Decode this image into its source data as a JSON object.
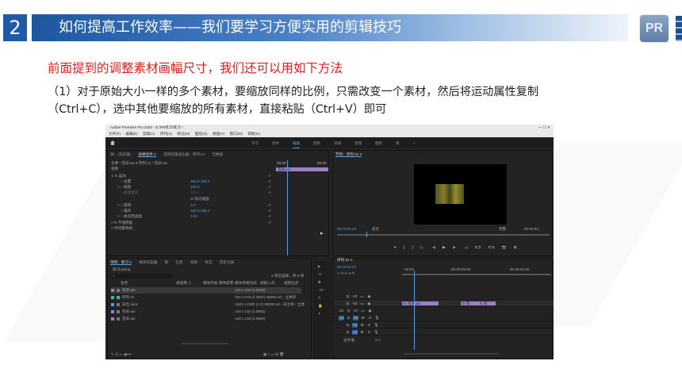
{
  "slide": {
    "number": "2",
    "title": "如何提高工作效率——我们要学习方便实用的剪辑技巧",
    "logo_text": "PR",
    "subtitle": "前面提到的调整素材画幅尺寸，我们还可以用如下方法",
    "paragraph": "（1）对于原始大小一样的多个素材，要缩放同样的比例，只需改变一个素材，然后将运动属性复制（Ctrl+C），选中其他要缩放的所有素材，直接粘贴（Ctrl+V）即可"
  },
  "app": {
    "window_title": "Adobe Premiere Pro 2020 - E:\\PR练习\\练习 *",
    "window_controls": "—  ☐  ✕",
    "menu": [
      "文件(F)",
      "编辑(E)",
      "剪辑(C)",
      "序列(S)",
      "标记(M)",
      "图形(G)",
      "视图(V)",
      "窗口(W)",
      "帮助(H)"
    ],
    "workspaces": [
      "学习",
      "组件",
      "编辑",
      "颜色",
      "效果",
      "音频",
      "图形",
      "库",
      "»"
    ],
    "active_workspace": "编辑",
    "effect_controls": {
      "tabs": [
        "源：(无剪辑)",
        "效果控件 ≡",
        "音频剪辑混合器：序列 01",
        "元数据"
      ],
      "source_row": "主要 * 花朵.avi  ▾   序列 01 * 花朵.avi",
      "video_label": "视频",
      "time_start": "00:00",
      "time_end": "00:00",
      "clip_label": "花朵.avi",
      "props": [
        {
          "name": "∨ fx 运动",
          "value": ""
        },
        {
          "name": "○ 位置",
          "value": "360.0   288.0"
        },
        {
          "name": "> ○ 缩放",
          "value": "100.0"
        },
        {
          "name": "○ 缩放宽度",
          "value": "100.0"
        },
        {
          "name": "",
          "value": "☑ 等比缩放"
        },
        {
          "name": "> ○ 旋转",
          "value": "0.0"
        },
        {
          "name": "○ 锚点",
          "value": "360.0   288.0"
        },
        {
          "name": "> ○ 防闪烁滤镜",
          "value": "0.00"
        },
        {
          "name": "> fx 不透明度",
          "value": ""
        },
        {
          "name": "> 时间重映射",
          "value": ""
        }
      ]
    },
    "program_monitor": {
      "tab": "节目：序列 01 ≡",
      "timecode": "00:00:01:02",
      "fit": "适合",
      "quality": "完整",
      "duration": "00:00:03",
      "controls": [
        "▾",
        "{",
        "}",
        "|←",
        "◂|",
        "▶",
        "|▸",
        "→|",
        "⊏⊐",
        "⊏⊐",
        "📷",
        "⊞"
      ]
    },
    "project": {
      "tabs": [
        "项目：练习 ≡",
        "媒体浏览器",
        "库",
        "信息",
        "效果",
        "标记",
        "历史记录"
      ],
      "file": "练习.prproj",
      "selection_info": "1 项已选择，共 6 项",
      "columns": [
        "名称",
        "帧速率 ∧",
        "媒体开始",
        "媒体结束",
        "媒体持续时间",
        "视频入点",
        "视频出点"
      ],
      "rows": [
        {
          "name": "花朵.avi",
          "fps": "",
          "info": "140 x 132 (1.0940)",
          "color": "#9b82c8",
          "selected": true
        },
        {
          "name": "序列 01",
          "fps": "",
          "info": "720 x 576 (1.4587)  48000 Hz - 立体声",
          "color": "#3dbd8b",
          "selected": false
        },
        {
          "name": "日出.mp4",
          "fps": "",
          "info": "1920 x 1080 (1.0)  48000 Hz - 日立体 - 立体",
          "color": "#4e9fe6",
          "selected": false
        },
        {
          "name": "花朵.avi",
          "fps": "",
          "info": "140 x 132 (1.0940)",
          "color": "#9b82c8",
          "selected": false
        },
        {
          "name": "花朵.avi",
          "fps": "",
          "info": "140 x 132 (1.0940)",
          "color": "#9b82c8",
          "selected": false
        }
      ]
    },
    "timeline": {
      "tab": "序列 01 ≡",
      "timecode": "00:00:01:02",
      "ruler": [
        ":00:00",
        "00:00:05:00",
        "00:00:10:00"
      ],
      "video_tracks": [
        "V3",
        "V2",
        "V1"
      ],
      "audio_tracks": [
        "A1",
        "A2",
        "A3"
      ],
      "master": "主声道",
      "master_value": "0.0",
      "clips": [
        {
          "label": "fx 花朵.avi",
          "track": "V2"
        },
        {
          "label": "fx 花朵.avi",
          "track": "V2"
        },
        {
          "label": "fx 花朵.avi",
          "track": "V2"
        }
      ]
    },
    "tools": [
      "▶",
      "⇥",
      "✥",
      "⊣⊢",
      "✎",
      "✋",
      "T"
    ]
  }
}
